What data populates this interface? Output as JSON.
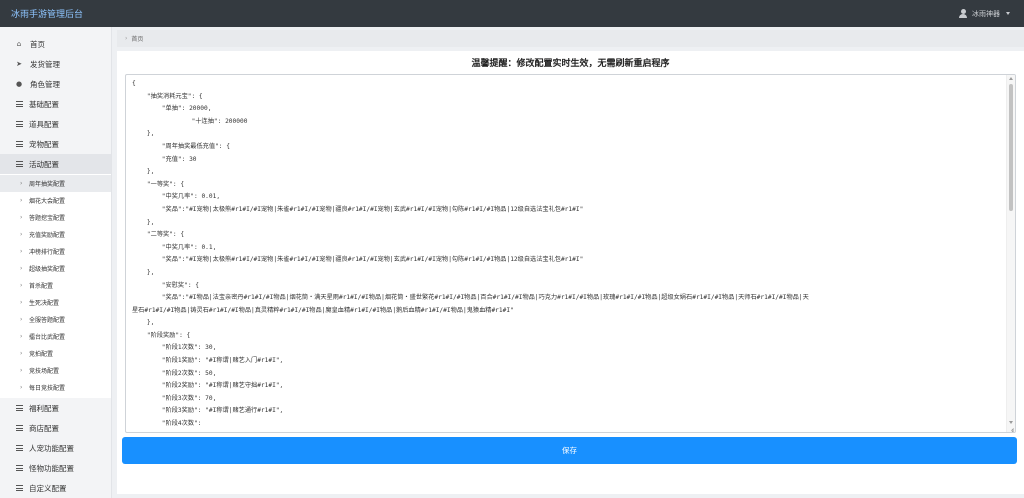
{
  "app": {
    "brand": "冰雨手游管理后台",
    "user_name": "冰雨神器"
  },
  "sidebar": {
    "items_top": [
      {
        "label": "首页",
        "icon": "home-icon",
        "glyph": "⌂"
      },
      {
        "label": "发货管理",
        "icon": "send-icon",
        "glyph": "➤"
      },
      {
        "label": "角色管理",
        "icon": "user-icon",
        "glyph": "●"
      },
      {
        "label": "基础配置",
        "icon": "menu-icon"
      },
      {
        "label": "道具配置",
        "icon": "menu-icon"
      },
      {
        "label": "宠物配置",
        "icon": "menu-icon"
      },
      {
        "label": "活动配置",
        "icon": "menu-icon"
      }
    ],
    "submenu": [
      "周年抽奖配置",
      "烟花大会配置",
      "答题挖宝配置",
      "充值奖励配置",
      "冲榜排行配置",
      "超级抽奖配置",
      "首杀配置",
      "生死决配置",
      "全服答题配置",
      "擂台比武配置",
      "竞拍配置",
      "竞技场配置",
      "每日竞技配置"
    ],
    "items_bottom": [
      {
        "label": "福利配置"
      },
      {
        "label": "商店配置"
      },
      {
        "label": "人宠功能配置"
      },
      {
        "label": "怪物功能配置"
      },
      {
        "label": "自定义配置"
      }
    ]
  },
  "breadcrumb": {
    "label": "首页"
  },
  "main": {
    "notice": "温馨提醒：修改配置实时生效，无需刷新重启程序",
    "save_label": "保存"
  },
  "editor": {
    "lines": [
      "{",
      "    \"抽奖消耗元宝\": {",
      "        \"单抽\": 20000,",
      "                \"十连抽\": 200000",
      "    },",
      "        \"周年抽奖最低充值\": {",
      "        \"充值\": 30",
      "    },",
      "    \"一等奖\": {",
      "        \"中奖几率\": 0.01,",
      "        \"奖品\":\"#I宠物|太极熊#r1#I/#I宠物|朱雀#r1#I/#I宠物|疆良#r1#I/#I宠物|玄武#r1#I/#I宠物|勾陈#r1#I/#I物品|12级自选法宝礼包#r1#I\"",
      "    },",
      "    \"二等奖\": {",
      "        \"中奖几率\": 0.1,",
      "        \"奖品\":\"#I宠物|太极熊#r1#I/#I宠物|朱雀#r1#I/#I宠物|疆良#r1#I/#I宠物|玄武#r1#I/#I宠物|勾陈#r1#I/#I物品|12级自选法宝礼包#r1#I\"",
      "    },",
      "        \"安慰奖\": {",
      "        \"奖品\":\"#I物品|法宝亲密丹#r1#I/#I物品|烟花筒・满天星雨#r1#I/#I物品|烟花筒・盛世繁花#r1#I/#I物品|百合#r1#I/#I物品|巧克力#r1#I/#I物品|玫瑰#r1#I/#I物品|超级女娲石#r1#I/#I物品|天师石#r1#I/#I物品|天",
      "星石#r1#I/#I物品|铸灵石#r1#I/#I物品|真灵精粹#r1#I/#I物品|魔皇血精#r1#I/#I物品|鹅后血精#r1#I/#I物品|鬼猿血精#r1#I\"",
      "    },",
      "    \"阶段奖励\": {",
      "        \"阶段1次数\": 30,",
      "        \"阶段1奖励\": \"#I称谓|赌艺入门#r1#I\",",
      "        \"阶段2次数\": 50,",
      "        \"阶段2奖励\": \"#I称谓|赌艺守拙#r1#I\",",
      "        \"阶段3次数\": 70,",
      "        \"阶段3奖励\": \"#I称谓|赌艺通行#r1#I\",",
      "        \"阶段4次数\":"
    ]
  }
}
